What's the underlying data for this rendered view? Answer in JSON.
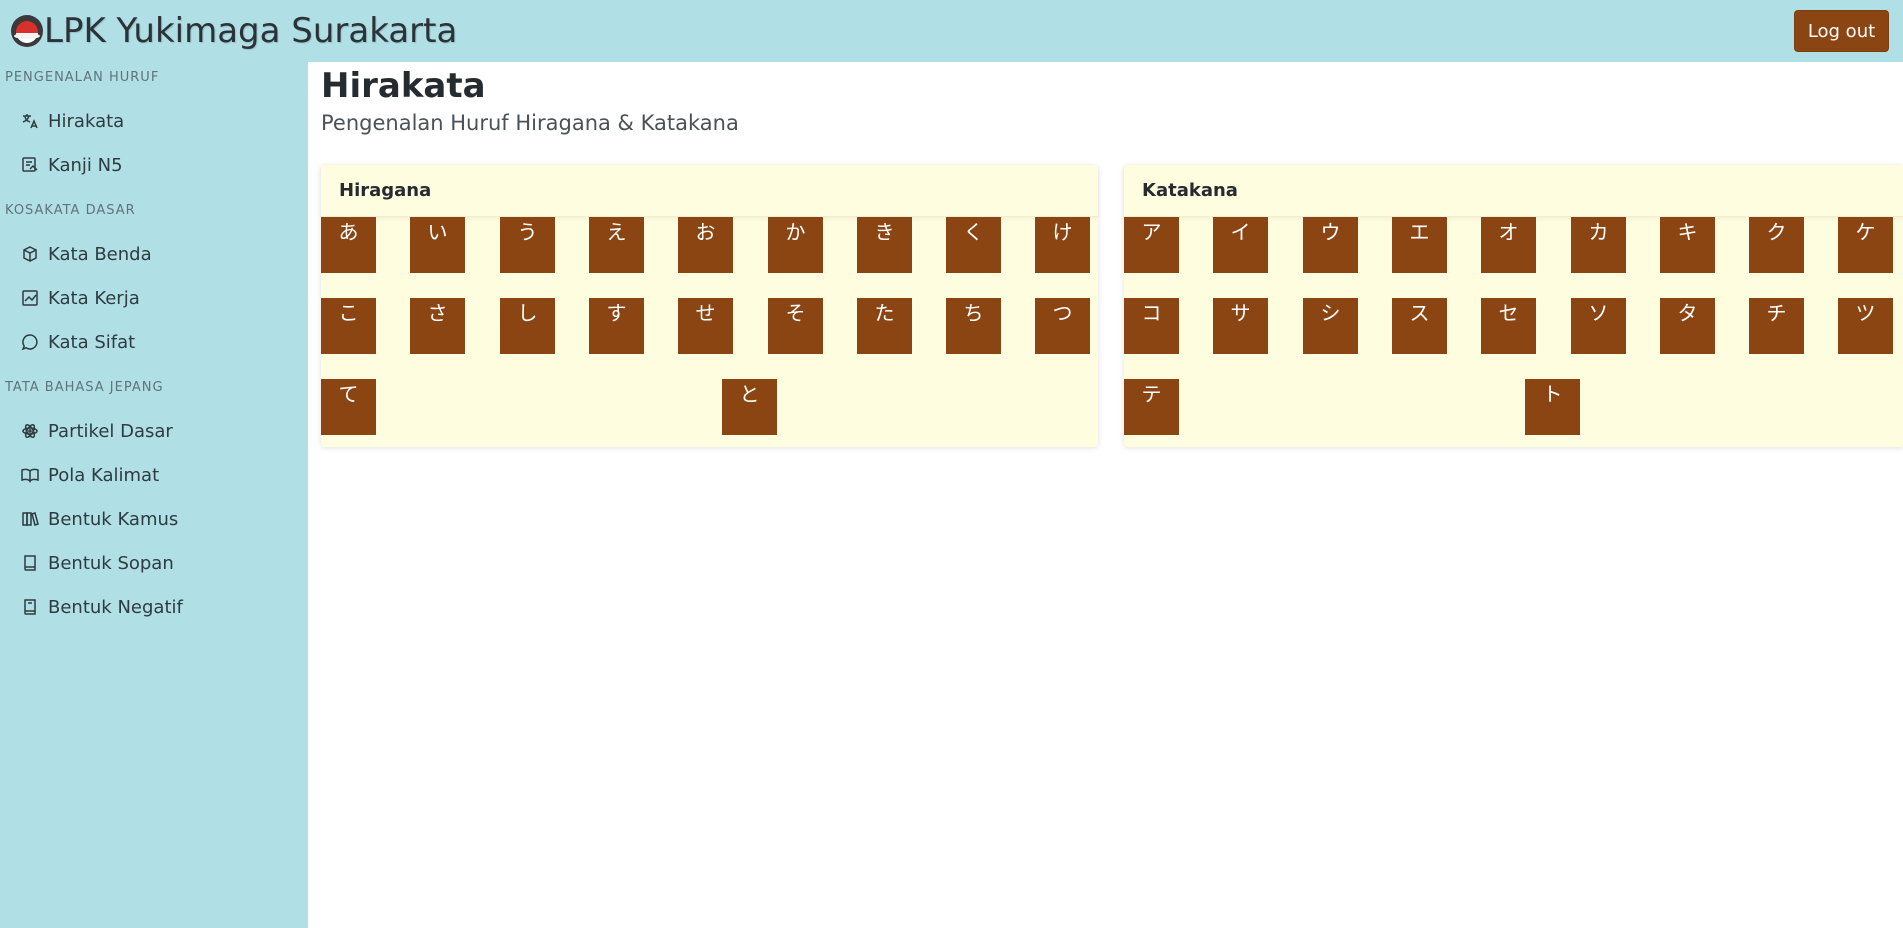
{
  "app": {
    "title": "LPK Yukimaga Surakarta",
    "logout_label": "Log out",
    "accent_color": "#8b4513",
    "bar_color": "#b0e0e6",
    "card_color": "#fffde0"
  },
  "sidebar": {
    "sections": [
      {
        "heading": "PENGENALAN HURUF",
        "items": [
          {
            "label": "Hirakata",
            "icon": "translate-icon"
          },
          {
            "label": "Kanji N5",
            "icon": "image-text-icon"
          }
        ]
      },
      {
        "heading": "KOSAKATA DASAR",
        "items": [
          {
            "label": "Kata Benda",
            "icon": "box-icon"
          },
          {
            "label": "Kata Kerja",
            "icon": "activity-icon"
          },
          {
            "label": "Kata Sifat",
            "icon": "chat-icon"
          }
        ]
      },
      {
        "heading": "TATA BAHASA JEPANG",
        "items": [
          {
            "label": "Partikel Dasar",
            "icon": "atom-icon"
          },
          {
            "label": "Pola Kalimat",
            "icon": "open-book-icon"
          },
          {
            "label": "Bentuk Kamus",
            "icon": "books-icon"
          },
          {
            "label": "Bentuk Sopan",
            "icon": "book-icon"
          },
          {
            "label": "Bentuk Negatif",
            "icon": "journal-icon"
          }
        ]
      }
    ]
  },
  "main": {
    "title": "Hirakata",
    "subtitle": "Pengenalan Huruf Hiragana & Katakana"
  },
  "hiragana": {
    "title": "Hiragana",
    "chars": [
      "あ",
      "い",
      "う",
      "え",
      "お",
      "か",
      "き",
      "く",
      "け",
      "こ",
      "さ",
      "し",
      "す",
      "せ",
      "そ",
      "た",
      "ち",
      "つ",
      "て",
      "と"
    ]
  },
  "katakana": {
    "title": "Katakana",
    "chars": [
      "ア",
      "イ",
      "ウ",
      "エ",
      "オ",
      "カ",
      "キ",
      "ク",
      "ケ",
      "コ",
      "サ",
      "シ",
      "ス",
      "セ",
      "ソ",
      "タ",
      "チ",
      "ツ",
      "テ",
      "ト"
    ]
  }
}
